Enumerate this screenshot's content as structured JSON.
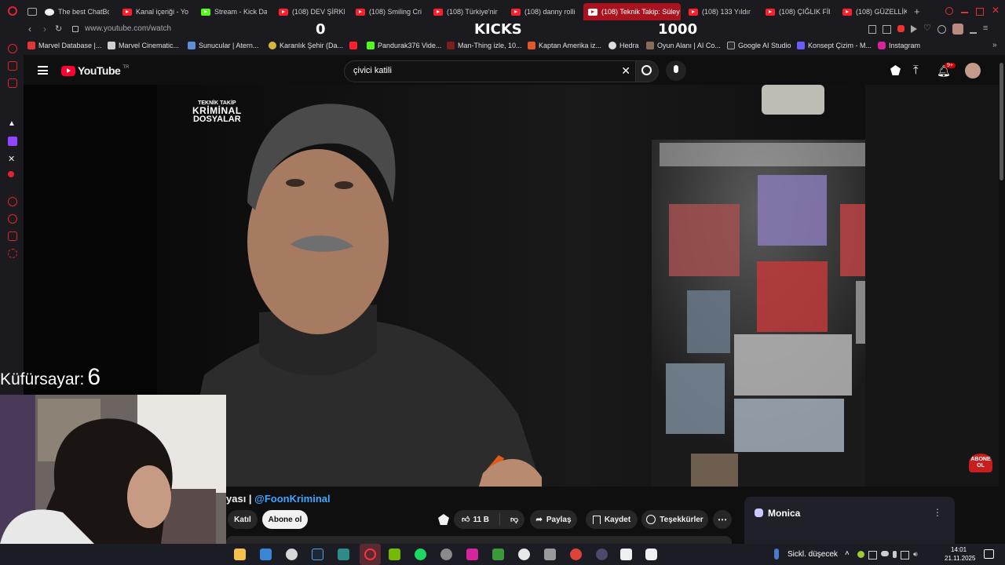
{
  "tabs": [
    {
      "label": "The best ChatBot"
    },
    {
      "label": "Kanal içeriği - Yo"
    },
    {
      "label": "Stream - Kick Da"
    },
    {
      "label": "(108) DEV ŞİRKE"
    },
    {
      "label": "(108) Smiling Crit"
    },
    {
      "label": "(108) Türkiye'nin"
    },
    {
      "label": "(108) danny rollin"
    },
    {
      "label": "(108) Teknik Takip: Süley"
    },
    {
      "label": "(108) 133 Yıldır Bu"
    },
    {
      "label": "(108) ÇIĞLIK FİLM"
    },
    {
      "label": "(108) GÜZELLİK K"
    }
  ],
  "address": {
    "url": "www.youtube.com/watch"
  },
  "overlay": {
    "left_count": "0",
    "center_title": "KICKS",
    "right_count": "1000",
    "swear_label": "Küfürsayar:",
    "swear_count": "6"
  },
  "bookmarks": [
    {
      "label": "Marvel Database |..."
    },
    {
      "label": "Marvel Cinematic..."
    },
    {
      "label": "Sunucular | Atern..."
    },
    {
      "label": "Karanlık Şehir (Da..."
    },
    {
      "label": "Pandurak376 Vide..."
    },
    {
      "label": "Man-Thing izle, 10..."
    },
    {
      "label": "Kaptan Amerika iz..."
    },
    {
      "label": "Hedra"
    },
    {
      "label": "Oyun Alanı | AI Co..."
    },
    {
      "label": "Google AI Studio"
    },
    {
      "label": "Konsept Çizim - M..."
    },
    {
      "label": "Instagram"
    }
  ],
  "youtube": {
    "logo_text": "YouTube",
    "region": "TR",
    "search_value": "çivici katili",
    "notif_badge": "9+"
  },
  "video": {
    "watermark_top": "TEKNİK TAKİP",
    "watermark_main": "KRİMİNAL",
    "watermark_sub": "DOSYALAR",
    "subscribe_badge_line1": "ABONE",
    "subscribe_badge_line2": "OL"
  },
  "channel": {
    "title_fragment": "yası | ",
    "handle": "@FoonKriminal",
    "join_label": "Katıl",
    "subscribe_label": "Abone ol"
  },
  "actions": {
    "likes": "11 B",
    "share": "Paylaş",
    "save": "Kaydet",
    "thanks": "Teşekkürler"
  },
  "monica": {
    "title": "Monica"
  },
  "taskbar": {
    "weather": "Sickl. düşecek",
    "time": "14:01",
    "date": "21.11.2025"
  },
  "colors": {
    "accent": "#ff0033",
    "active_tab": "#a8131f"
  }
}
